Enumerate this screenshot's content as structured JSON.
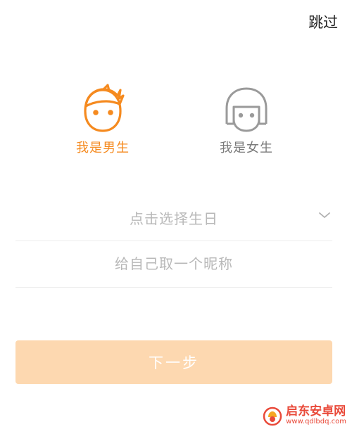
{
  "header": {
    "skip_label": "跳过"
  },
  "gender": {
    "male_label": "我是男生",
    "female_label": "我是女生",
    "selected": "male",
    "active_color": "#f58a1f",
    "inactive_color": "#8a8a8a"
  },
  "form": {
    "birthday_placeholder": "点击选择生日",
    "nickname_placeholder": "给自己取一个昵称",
    "nickname_value": ""
  },
  "actions": {
    "next_label": "下一步",
    "next_color": "#fdd8b0"
  },
  "watermark": {
    "name": "启东安卓网",
    "url": "www.qdlbdq.com",
    "color": "#e94a3a"
  },
  "icons": {
    "male_avatar": "boy-face-icon",
    "female_avatar": "girl-face-icon",
    "dropdown": "chevron-down-icon"
  }
}
